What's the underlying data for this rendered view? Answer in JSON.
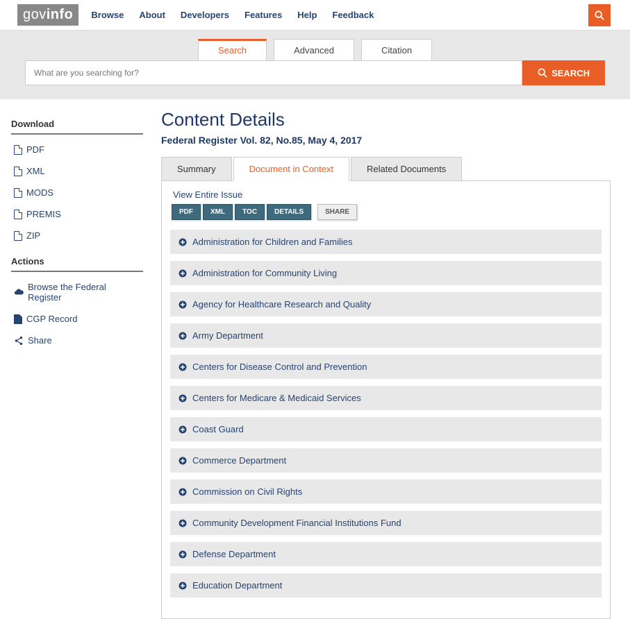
{
  "nav": {
    "logo_gov": "gov",
    "logo_info": "info",
    "links": [
      "Browse",
      "About",
      "Developers",
      "Features",
      "Help",
      "Feedback"
    ]
  },
  "search": {
    "tabs": [
      "Search",
      "Advanced",
      "Citation"
    ],
    "placeholder": "What are you searching for?",
    "button": "SEARCH"
  },
  "sidebar": {
    "download_h": "Download",
    "downloads": [
      "PDF",
      "XML",
      "MODS",
      "PREMIS",
      "ZIP"
    ],
    "actions_h": "Actions",
    "actions": [
      {
        "icon": "cloud",
        "label": "Browse the Federal Register"
      },
      {
        "icon": "file",
        "label": "CGP Record"
      },
      {
        "icon": "share",
        "label": "Share"
      }
    ]
  },
  "content": {
    "title": "Content Details",
    "subtitle": "Federal Register Vol. 82, No.85, May 4, 2017",
    "tabs": [
      "Summary",
      "Document in Context",
      "Related Documents"
    ],
    "view_link": "View Entire Issue",
    "buttons": [
      "PDF",
      "XML",
      "TOC",
      "DETAILS"
    ],
    "share_btn": "SHARE",
    "agencies": [
      "Administration for Children and Families",
      "Administration for Community Living",
      "Agency for Healthcare Research and Quality",
      "Army Department",
      "Centers for Disease Control and Prevention",
      "Centers for Medicare & Medicaid Services",
      "Coast Guard",
      "Commerce Department",
      "Commission on Civil Rights",
      "Community Development Financial Institutions Fund",
      "Defense Department",
      "Education Department"
    ]
  }
}
